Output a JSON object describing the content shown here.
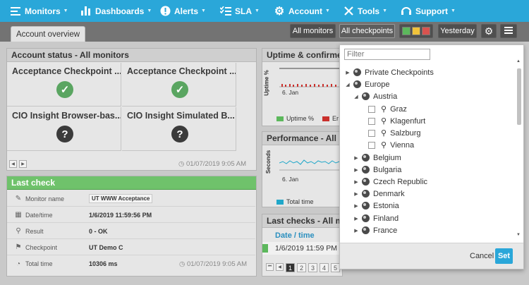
{
  "nav": {
    "items": [
      {
        "label": "Monitors",
        "icon": "list-icon"
      },
      {
        "label": "Dashboards",
        "icon": "bar-chart-icon"
      },
      {
        "label": "Alerts",
        "icon": "alert-icon"
      },
      {
        "label": "SLA",
        "icon": "checklist-icon"
      },
      {
        "label": "Account",
        "icon": "gear-icon"
      },
      {
        "label": "Tools",
        "icon": "tools-icon"
      },
      {
        "label": "Support",
        "icon": "headset-icon"
      }
    ],
    "caret": "▼"
  },
  "toolbar": {
    "tab_label": "Account overview",
    "all_monitors": "All monitors",
    "all_checkpoints": "All checkpoints",
    "yesterday": "Yesterday",
    "status_colors": [
      "#5cb85c",
      "#f0c23b",
      "#d9534f"
    ]
  },
  "account_status": {
    "title": "Account status - All monitors",
    "tiles": [
      {
        "title": "Acceptance Checkpoint ...",
        "status": "ok"
      },
      {
        "title": "Acceptance Checkpoint ...",
        "status": "ok"
      },
      {
        "title": "CIO Insight Browser-bas...",
        "status": "unknown"
      },
      {
        "title": "CIO Insight Simulated B...",
        "status": "unknown"
      }
    ],
    "timestamp": "01/07/2019 9:05 AM"
  },
  "last_check": {
    "title": "Last check",
    "rows": [
      {
        "label": "Monitor name",
        "value": "UT WWW Acceptance"
      },
      {
        "label": "Date/time",
        "value": "1/6/2019 11:59:56 PM"
      },
      {
        "label": "Result",
        "value": "0 - OK"
      },
      {
        "label": "Checkpoint",
        "value": "UT Demo C"
      },
      {
        "label": "Total time",
        "value": "10306 ms"
      }
    ],
    "timestamp": "01/07/2019 9:05 AM"
  },
  "uptime": {
    "title": "Uptime & confirmed",
    "ylabel": "Uptime %",
    "xtick": "6. Jan",
    "legend_uptime": "Uptime %",
    "legend_err": "Er"
  },
  "performance": {
    "title": "Performance - All m",
    "ylabel": "Seconds",
    "xtick": "6. Jan",
    "legend": "Total time"
  },
  "last_checks": {
    "title": "Last checks - All mo",
    "col_header": "Date / time",
    "row_value": "1/6/2019 11:59 PM",
    "pages": [
      "1",
      "2",
      "3",
      "4",
      "5"
    ]
  },
  "dropdown": {
    "filter_placeholder": "Filter",
    "tree": [
      {
        "label": "Private Checkpoints",
        "level": 0,
        "kind": "region",
        "expanded": false
      },
      {
        "label": "Europe",
        "level": 0,
        "kind": "region",
        "expanded": true
      },
      {
        "label": "Austria",
        "level": 1,
        "kind": "country",
        "expanded": true
      },
      {
        "label": "Graz",
        "level": 2,
        "kind": "city"
      },
      {
        "label": "Klagenfurt",
        "level": 2,
        "kind": "city"
      },
      {
        "label": "Salzburg",
        "level": 2,
        "kind": "city"
      },
      {
        "label": "Vienna",
        "level": 2,
        "kind": "city"
      },
      {
        "label": "Belgium",
        "level": 1,
        "kind": "country",
        "expanded": false
      },
      {
        "label": "Bulgaria",
        "level": 1,
        "kind": "country",
        "expanded": false
      },
      {
        "label": "Czech Republic",
        "level": 1,
        "kind": "country",
        "expanded": false
      },
      {
        "label": "Denmark",
        "level": 1,
        "kind": "country",
        "expanded": false
      },
      {
        "label": "Estonia",
        "level": 1,
        "kind": "country",
        "expanded": false
      },
      {
        "label": "Finland",
        "level": 1,
        "kind": "country",
        "expanded": false
      },
      {
        "label": "France",
        "level": 1,
        "kind": "country",
        "expanded": false
      }
    ],
    "cancel": "Cancel",
    "set": "Set"
  }
}
